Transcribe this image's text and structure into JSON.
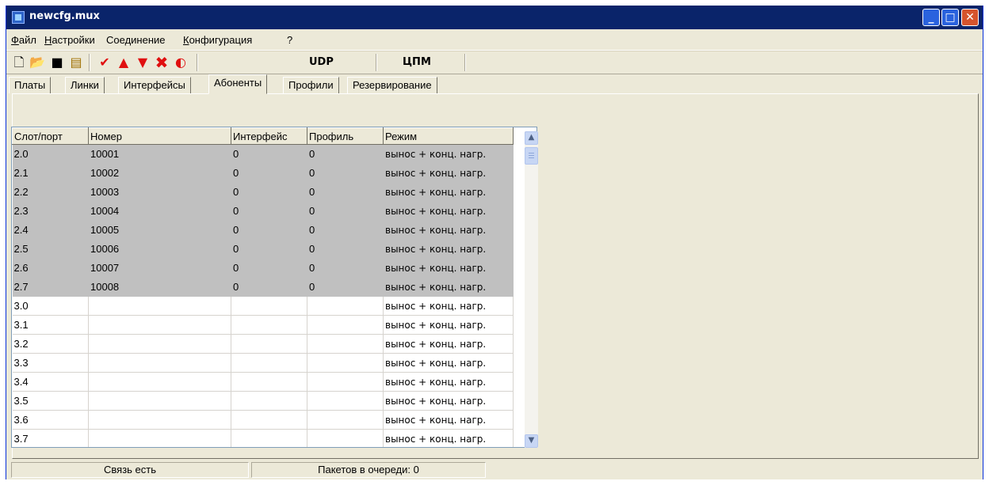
{
  "window": {
    "title": "newcfg.mux"
  },
  "menu": [
    {
      "label": "Файл",
      "underline": "Ф",
      "rest": "айл"
    },
    {
      "label": "Настройки",
      "underline": "Н",
      "rest": "астройки"
    },
    {
      "label": "Соединение",
      "underline": "",
      "rest": "Соединение"
    },
    {
      "label": "Конфигурация",
      "underline": "К",
      "rest": "онфигурация"
    },
    {
      "label": "?",
      "underline": "",
      "rest": "?"
    }
  ],
  "toolbar": {
    "icons": [
      "new-document-icon",
      "open-folder-icon",
      "save-icon",
      "properties-icon",
      "check-icon",
      "arrow-up-icon",
      "arrow-down-icon",
      "delete-icon",
      "refresh-icon"
    ],
    "udp_label": "UDP",
    "cpm_label": "ЦПМ"
  },
  "tabs": [
    "Платы",
    "Линки",
    "Интерфейсы",
    "Абоненты",
    "Профили",
    "Резервирование"
  ],
  "active_tab": "Абоненты",
  "table": {
    "columns": [
      "Слот/порт",
      "Номер",
      "Интерфейс",
      "Профиль",
      "Режим"
    ],
    "rows": [
      {
        "slot": "2.0",
        "number": "10001",
        "iface": "0",
        "profile": "0",
        "mode": "вынос + конц. нагр."
      },
      {
        "slot": "2.1",
        "number": "10002",
        "iface": "0",
        "profile": "0",
        "mode": "вынос + конц. нагр."
      },
      {
        "slot": "2.2",
        "number": "10003",
        "iface": "0",
        "profile": "0",
        "mode": "вынос + конц. нагр."
      },
      {
        "slot": "2.3",
        "number": "10004",
        "iface": "0",
        "profile": "0",
        "mode": "вынос + конц. нагр."
      },
      {
        "slot": "2.4",
        "number": "10005",
        "iface": "0",
        "profile": "0",
        "mode": "вынос + конц. нагр."
      },
      {
        "slot": "2.5",
        "number": "10006",
        "iface": "0",
        "profile": "0",
        "mode": "вынос + конц. нагр."
      },
      {
        "slot": "2.6",
        "number": "10007",
        "iface": "0",
        "profile": "0",
        "mode": "вынос + конц. нагр."
      },
      {
        "slot": "2.7",
        "number": "10008",
        "iface": "0",
        "profile": "0",
        "mode": "вынос + конц. нагр."
      },
      {
        "slot": "3.0",
        "number": "",
        "iface": "",
        "profile": "",
        "mode": "вынос + конц. нагр."
      },
      {
        "slot": "3.1",
        "number": "",
        "iface": "",
        "profile": "",
        "mode": "вынос + конц. нагр."
      },
      {
        "slot": "3.2",
        "number": "",
        "iface": "",
        "profile": "",
        "mode": "вынос + конц. нагр."
      },
      {
        "slot": "3.3",
        "number": "",
        "iface": "",
        "profile": "",
        "mode": "вынос + конц. нагр."
      },
      {
        "slot": "3.4",
        "number": "",
        "iface": "",
        "profile": "",
        "mode": "вынос + конц. нагр."
      },
      {
        "slot": "3.5",
        "number": "",
        "iface": "",
        "profile": "",
        "mode": "вынос + конц. нагр."
      },
      {
        "slot": "3.6",
        "number": "",
        "iface": "",
        "profile": "",
        "mode": "вынос + конц. нагр."
      },
      {
        "slot": "3.7",
        "number": "",
        "iface": "",
        "profile": "",
        "mode": "вынос + конц. нагр."
      }
    ]
  },
  "status": {
    "connection": "Связь есть",
    "queue": "Пакетов в очереди: 0"
  }
}
